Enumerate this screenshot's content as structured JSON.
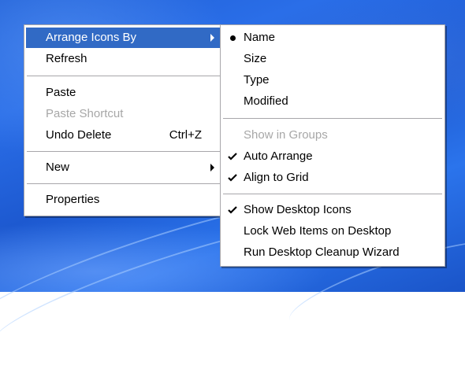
{
  "context_menu": {
    "items": [
      {
        "label": "Arrange Icons By"
      },
      {
        "label": "Refresh"
      },
      {
        "label": "Paste"
      },
      {
        "label": "Paste Shortcut"
      },
      {
        "label": "Undo Delete",
        "shortcut": "Ctrl+Z"
      },
      {
        "label": "New"
      },
      {
        "label": "Properties"
      }
    ]
  },
  "submenu": {
    "items": [
      {
        "label": "Name"
      },
      {
        "label": "Size"
      },
      {
        "label": "Type"
      },
      {
        "label": "Modified"
      },
      {
        "label": "Show in Groups"
      },
      {
        "label": "Auto Arrange"
      },
      {
        "label": "Align to Grid"
      },
      {
        "label": "Show Desktop Icons"
      },
      {
        "label": "Lock Web Items on Desktop"
      },
      {
        "label": "Run Desktop Cleanup Wizard"
      }
    ]
  },
  "colors": {
    "highlight": "#316ac5",
    "disabled_text": "#a7a7a7",
    "menu_border": "#a7a6aa"
  }
}
